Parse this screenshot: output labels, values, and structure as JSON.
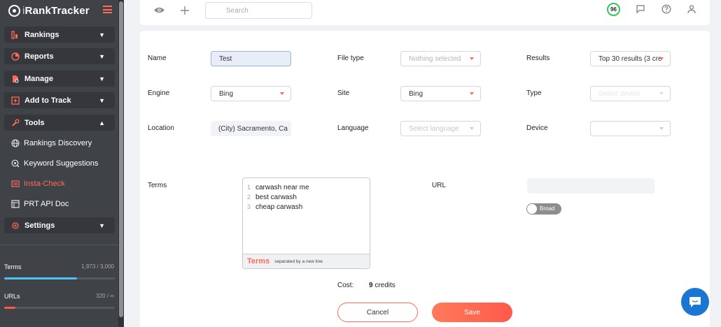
{
  "app": {
    "logo_text_a": "i",
    "logo_text_b": "RankTracker"
  },
  "nav": {
    "rankings": "Rankings",
    "reports": "Reports",
    "manage": "Manage",
    "add_to_track": "Add to Track",
    "tools": "Tools",
    "tools_sub": [
      "Rankings Discovery",
      "Keyword Suggestions",
      "Insta-Check",
      "PRT API Doc"
    ],
    "settings": "Settings"
  },
  "stats": {
    "terms_label": "Terms",
    "terms_value": "1,973 / 3,000",
    "terms_fraction": 0.66,
    "urls_label": "URLs",
    "urls_value": "320 / ∞",
    "urls_fraction": 0.1
  },
  "topbar": {
    "search_placeholder": "Search",
    "score": "96"
  },
  "form": {
    "name_label": "Name",
    "name_value": "Test",
    "filetype_label": "File type",
    "filetype_value": "Nothing selected",
    "results_label": "Results",
    "results_value": "Top 30 results (3 cre",
    "engine_label": "Engine",
    "engine_value": "Bing",
    "site_label": "Site",
    "site_value": "Bing",
    "type_label": "Type",
    "type_value": "Select device",
    "location_label": "Location",
    "location_value": "(City) Sacramento, Ca",
    "language_label": "Language",
    "language_value": "Select language",
    "device_label": "Device",
    "device_value": "",
    "terms_label": "Terms",
    "terms": [
      "carwash near me",
      "best carwash",
      "cheap carwash"
    ],
    "terms_line_numbers": [
      "1",
      "2",
      "3"
    ],
    "terms_footer_title": "Terms",
    "terms_footer_hint": "separated by a new line",
    "url_label": "URL",
    "broad_label": "Broad",
    "cost_label": "Cost:",
    "cost_value": "9",
    "cost_unit": "credits",
    "cancel_label": "Cancel",
    "save_label": "Save"
  },
  "colors": {
    "accent": "#ff6b57",
    "sidebar": "#3f4247",
    "terms_bar": "#4fc3f7",
    "urls_bar": "#ff5a4a",
    "chat": "#1976d2",
    "score_ring": "#34c759"
  }
}
